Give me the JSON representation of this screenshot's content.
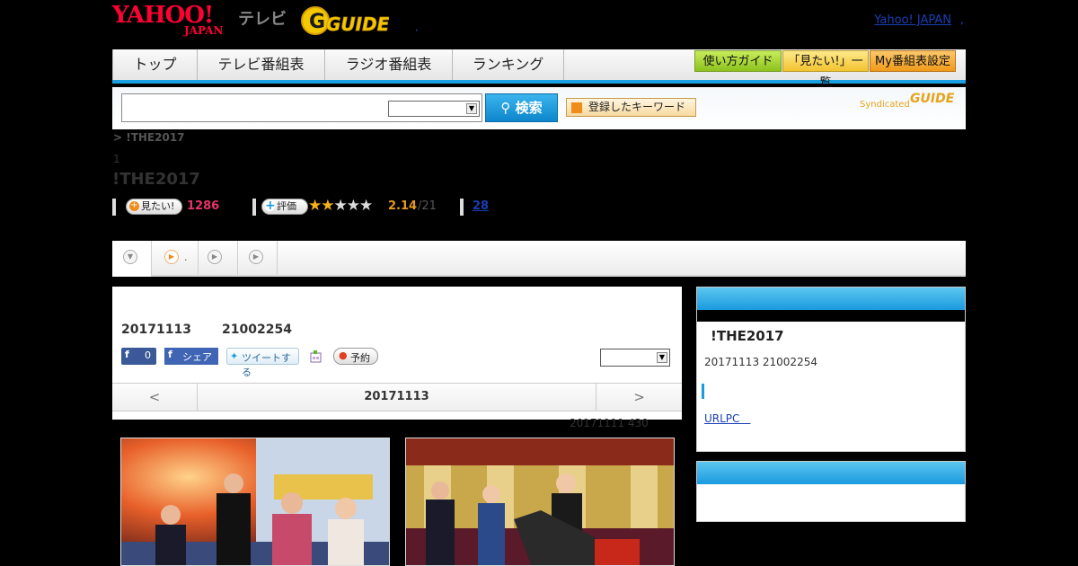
{
  "header": {
    "logo_yahoo": "YAHOO!",
    "logo_japan": "JAPAN",
    "logo_tv": "テレビ",
    "logo_gguide": "GUIDE",
    "dot": ",",
    "yahoo_japan_link": "Yahoo! JAPAN",
    "yj_dot": ","
  },
  "nav": {
    "tabs": [
      "トップ",
      "テレビ番組表",
      "ラジオ番組表",
      "ランキング"
    ],
    "buttons": [
      "使い方ガイド",
      "「見たい!」一覧",
      "My番組表設定"
    ]
  },
  "search": {
    "input_value": "",
    "select_value": "",
    "search_button": "検索",
    "keyword_button": "登録したキーワード",
    "syndicated": "Syndicated",
    "syndicated_logo": "GUIDE"
  },
  "program": {
    "breadcrumb": "> !THE2017",
    "number": "1",
    "title": "!THE2017",
    "watch_label": "見たい!",
    "watch_count": "1286",
    "rate_label": "評価",
    "rating": "2.14",
    "rating_count": "/21",
    "review_count": "28"
  },
  "tabstrip": {
    "tab2_label": "."
  },
  "detail": {
    "date": "20171113",
    "id": "21002254",
    "fb_like_count": "0",
    "fb_share": "シェア",
    "tweet": "ツイートする",
    "reserve": "予約",
    "select_value": "",
    "prev": "<",
    "next": ">",
    "day": "20171113",
    "caption": "20171111  430"
  },
  "sidebar": {
    "title": "!THE2017",
    "info": "20171113  21002254",
    "url_link": "URLPC　"
  }
}
